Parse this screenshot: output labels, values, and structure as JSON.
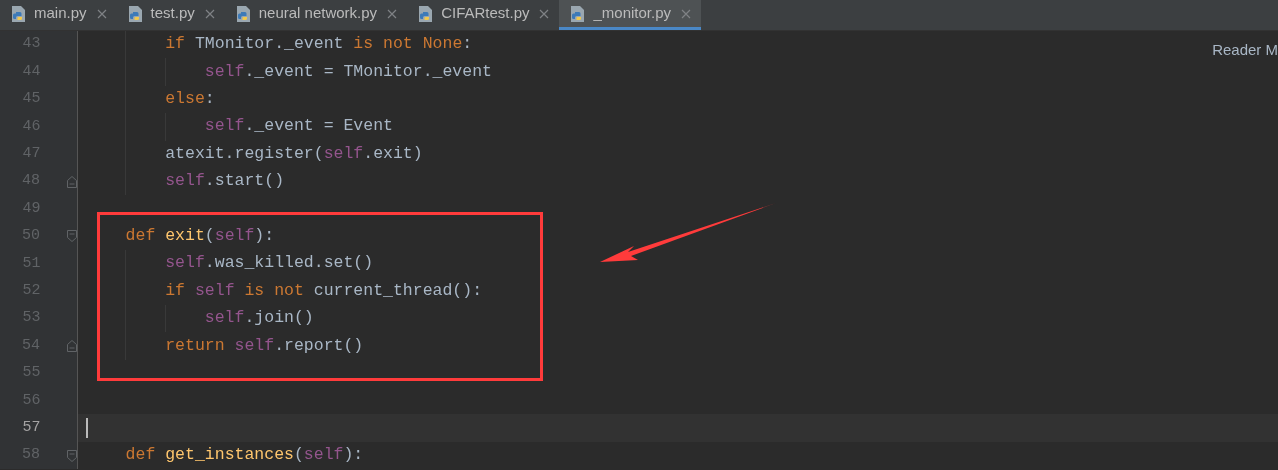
{
  "tabs": [
    {
      "label": "main.py",
      "selected": false
    },
    {
      "label": "test.py",
      "selected": false
    },
    {
      "label": "neural network.py",
      "selected": false
    },
    {
      "label": "CIFARtest.py",
      "selected": false
    },
    {
      "label": "_monitor.py",
      "selected": true
    }
  ],
  "editor": {
    "hint": "Reader M",
    "lines": [
      {
        "number": "43",
        "current": false,
        "tokens": [
          {
            "kind": "keyword",
            "t": "        if"
          },
          {
            "kind": "plain",
            "t": " TMonitor._event "
          },
          {
            "kind": "keyword",
            "t": "is not None"
          },
          {
            "kind": "plain",
            "t": ":"
          }
        ]
      },
      {
        "number": "44",
        "current": false,
        "tokens": [
          {
            "kind": "self",
            "t": "            self"
          },
          {
            "kind": "plain",
            "t": "._event = TMonitor._event"
          }
        ]
      },
      {
        "number": "45",
        "current": false,
        "tokens": [
          {
            "kind": "keyword",
            "t": "        else"
          },
          {
            "kind": "plain",
            "t": ":"
          }
        ]
      },
      {
        "number": "46",
        "current": false,
        "tokens": [
          {
            "kind": "self",
            "t": "            self"
          },
          {
            "kind": "plain",
            "t": "._event = Event"
          }
        ]
      },
      {
        "number": "47",
        "current": false,
        "tokens": [
          {
            "kind": "plain",
            "t": "        atexit.register("
          },
          {
            "kind": "self",
            "t": "self"
          },
          {
            "kind": "plain",
            "t": ".exit)"
          }
        ]
      },
      {
        "number": "48",
        "current": false,
        "fold": {
          "kind": "end"
        },
        "tokens": [
          {
            "kind": "self",
            "t": "        self"
          },
          {
            "kind": "plain",
            "t": ".start()"
          }
        ]
      },
      {
        "number": "49",
        "current": false
      },
      {
        "number": "50",
        "current": false,
        "fold": {
          "kind": "start"
        },
        "tokens": [
          {
            "kind": "keyword",
            "t": "    def "
          },
          {
            "kind": "function",
            "t": "exit"
          },
          {
            "kind": "plain",
            "t": "("
          },
          {
            "kind": "self",
            "t": "self"
          },
          {
            "kind": "plain",
            "t": "):"
          }
        ]
      },
      {
        "number": "51",
        "current": false,
        "tokens": [
          {
            "kind": "self",
            "t": "        self"
          },
          {
            "kind": "plain",
            "t": ".was_killed.set()"
          }
        ]
      },
      {
        "number": "52",
        "current": false,
        "tokens": [
          {
            "kind": "keyword",
            "t": "        if "
          },
          {
            "kind": "self",
            "t": "self"
          },
          {
            "kind": "keyword",
            "t": " is not "
          },
          {
            "kind": "plain",
            "t": "current_thread():"
          }
        ]
      },
      {
        "number": "53",
        "current": false,
        "tokens": [
          {
            "kind": "self",
            "t": "            self"
          },
          {
            "kind": "plain",
            "t": ".join()"
          }
        ]
      },
      {
        "number": "54",
        "current": false,
        "fold": {
          "kind": "end"
        },
        "tokens": [
          {
            "kind": "keyword",
            "t": "        return "
          },
          {
            "kind": "self",
            "t": "self"
          },
          {
            "kind": "plain",
            "t": ".report()"
          }
        ]
      },
      {
        "number": "55",
        "current": false
      },
      {
        "number": "56",
        "current": false
      },
      {
        "number": "57",
        "current": true
      },
      {
        "number": "58",
        "current": false,
        "fold": {
          "kind": "start"
        },
        "tokens": [
          {
            "kind": "keyword",
            "t": "    def "
          },
          {
            "kind": "function",
            "t": "get_instances"
          },
          {
            "kind": "plain",
            "t": "("
          },
          {
            "kind": "self",
            "t": "self"
          },
          {
            "kind": "plain",
            "t": "):"
          }
        ]
      }
    ]
  }
}
